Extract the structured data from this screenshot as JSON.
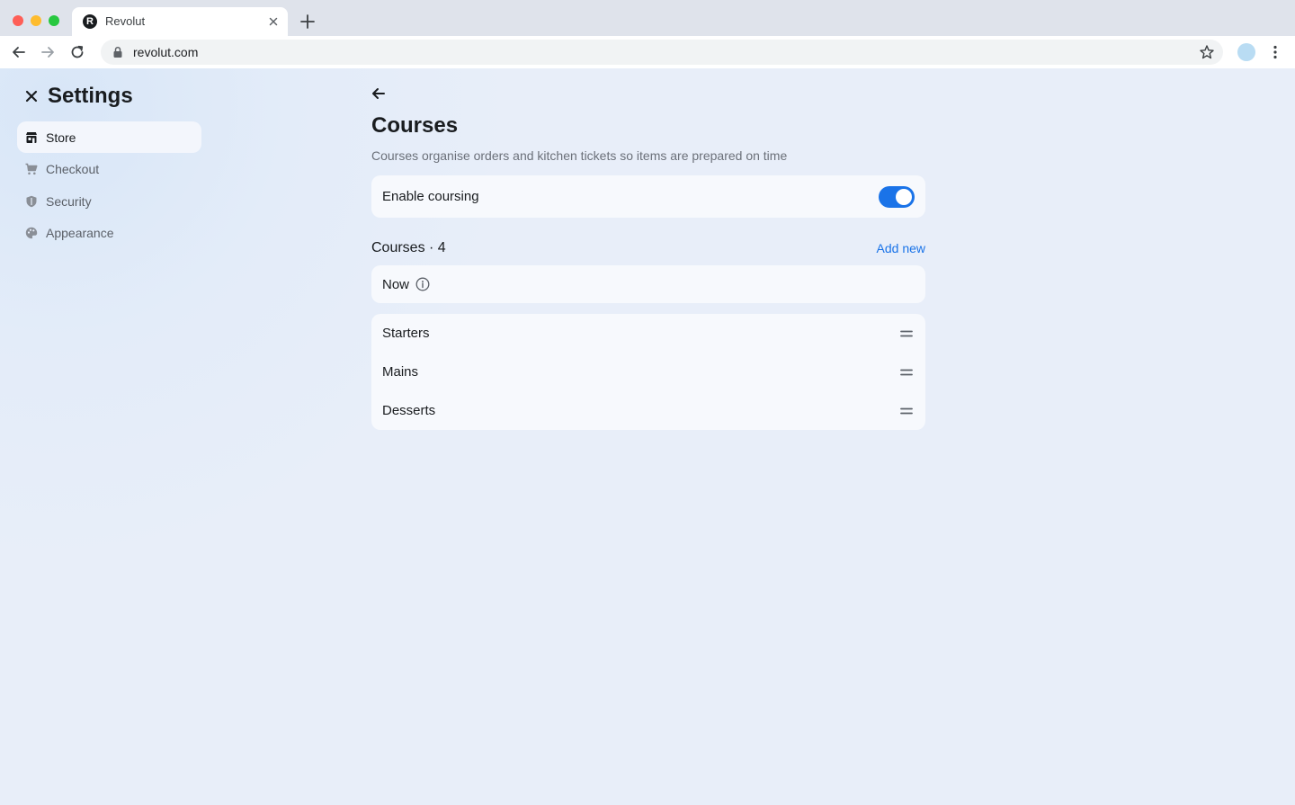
{
  "browser": {
    "tab_title": "Revolut",
    "favicon_letter": "R",
    "url": "revolut.com"
  },
  "settings": {
    "title": "Settings",
    "nav": [
      {
        "label": "Store",
        "icon": "store-icon",
        "active": true
      },
      {
        "label": "Checkout",
        "icon": "cart-icon",
        "active": false
      },
      {
        "label": "Security",
        "icon": "shield-icon",
        "active": false
      },
      {
        "label": "Appearance",
        "icon": "palette-icon",
        "active": false
      }
    ]
  },
  "courses": {
    "title": "Courses",
    "description": "Courses organise orders and kitchen tickets so items are prepared on time",
    "enable_label": "Enable coursing",
    "enabled": true,
    "section_title": "Courses · 4",
    "add_new": "Add new",
    "fixed_course": "Now",
    "items": [
      "Starters",
      "Mains",
      "Desserts"
    ]
  },
  "colors": {
    "accent": "#1a73e8",
    "background": "#e8eef9",
    "card": "#f7f9fd"
  }
}
